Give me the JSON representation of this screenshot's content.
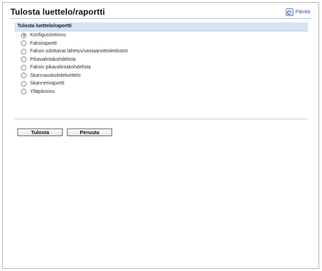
{
  "header": {
    "title": "Tulosta luettelo/raportti",
    "refresh_label": "Päivitä",
    "refresh_icon": "refresh-icon"
  },
  "section": {
    "heading": "Tulosta luettelo/raportti"
  },
  "options": [
    {
      "label": "Konfigurointisivu",
      "selected": true
    },
    {
      "label": "Faksiraportti",
      "selected": false
    },
    {
      "label": "Faksin odottavat lähetys/vastaanottotiedostot",
      "selected": false
    },
    {
      "label": "Pikavalintakohdelista",
      "selected": false
    },
    {
      "label": "Faksin pikavalintakohdelista",
      "selected": false
    },
    {
      "label": "Skannauskohdeluettelo",
      "selected": false
    },
    {
      "label": "Skanneriraportti",
      "selected": false
    },
    {
      "label": "Ylläpitosivu",
      "selected": false
    }
  ],
  "buttons": {
    "print_label": "Tulosta",
    "cancel_label": "Peruuta"
  },
  "colors": {
    "section_background": "#d6e3f5",
    "radio_selected": "#2f9a2f",
    "link": "#2a4fa0"
  }
}
